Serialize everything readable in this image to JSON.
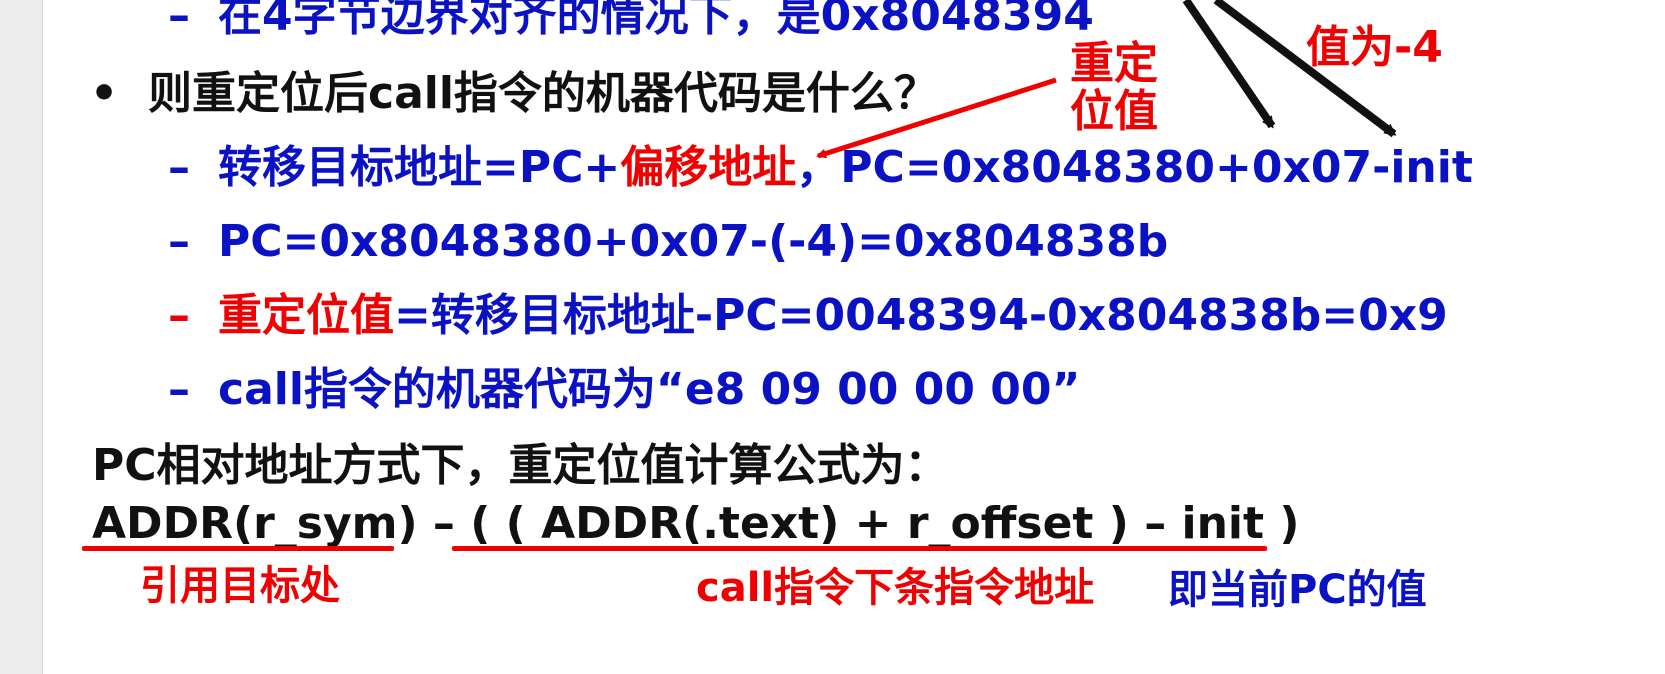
{
  "colors": {
    "blue": "#0a12c4",
    "red": "#f00000",
    "black": "#111111"
  },
  "slide": {
    "line_top": {
      "dash": "–",
      "text": "在4字节边界对齐的情况下，是0x8048394"
    },
    "question": {
      "bullet": "•",
      "text": "则重定位后call指令的机器代码是什么？"
    },
    "step1": {
      "dash": "–",
      "part1": "转移目标地址=PC+",
      "part2_red": "偏移地址",
      "part3": "，PC=0x8048380+0x07-init"
    },
    "step2": {
      "dash": "–",
      "text": "PC=0x8048380+0x07-(-4)=0x804838b"
    },
    "step3": {
      "dash": "–",
      "part1_red": "重定位值",
      "part2": "=转移目标地址-PC=0048394-0x804838b=0x9"
    },
    "step4": {
      "dash": "–",
      "text": "call指令的机器代码为“e8 09 00 00 00”"
    },
    "formula": {
      "title": "PC相对地址方式下，重定位值计算公式为：",
      "expression": "ADDR(r_sym) – ( ( ADDR(.text)  +  r_offset ) – init )"
    },
    "annotations": {
      "relocation_value_line1": "重定",
      "relocation_value_line2": "位值",
      "value_is": "值为-4",
      "reference_target": "引用目标处",
      "next_instruction_address": "call指令下条指令地址",
      "current_pc": "即当前PC的值"
    }
  }
}
